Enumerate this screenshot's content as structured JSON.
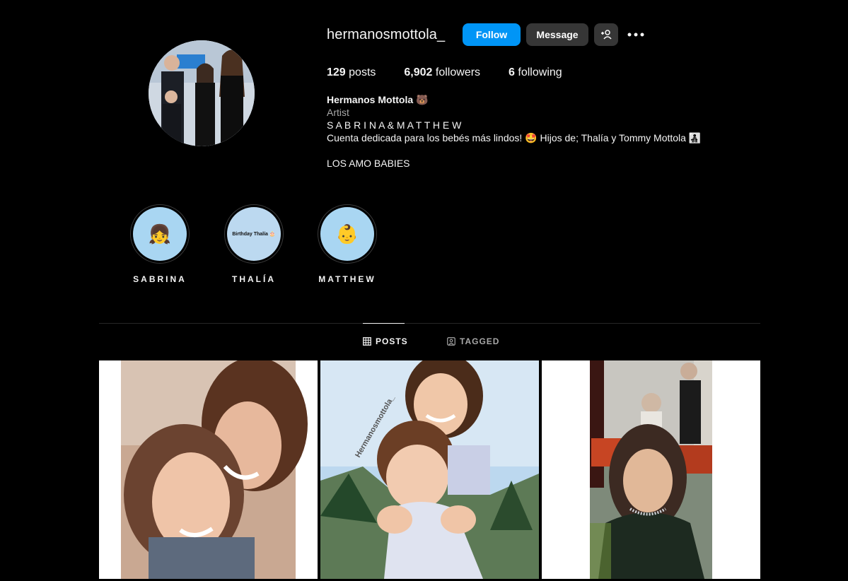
{
  "profile": {
    "username": "hermanosmottola_",
    "full_name": "Hermanos Mottola 🐻",
    "category": "Artist",
    "bio_lines": [
      "S A B R I N A & M A T T H E W",
      "Cuenta dedicada para los bebés más lindos! 🤩 Hijos de; Thalía y Tommy Mottola 👨‍👧‍👦",
      "LOS AMO BABIES"
    ]
  },
  "actions": {
    "follow_label": "Follow",
    "message_label": "Message",
    "add_user_icon": "add-user-icon",
    "more_icon": "more-options-icon"
  },
  "stats": {
    "posts_count": "129",
    "posts_label": "posts",
    "followers_count": "6,902",
    "followers_label": "followers",
    "following_count": "6",
    "following_label": "following"
  },
  "highlights": [
    {
      "label": "SABRINA",
      "cover": "👧"
    },
    {
      "label": "THALÍA",
      "cover": "Birthday Thalía 🎂"
    },
    {
      "label": "MATTHEW",
      "cover": "👶"
    }
  ],
  "tabs": [
    {
      "label": "POSTS",
      "icon": "grid-icon",
      "active": true
    },
    {
      "label": "TAGGED",
      "icon": "tagged-icon",
      "active": false
    }
  ],
  "posts": [
    {
      "alt": "photo-1"
    },
    {
      "alt": "photo-2",
      "watermark": "Hermanosmottola_"
    },
    {
      "alt": "photo-3"
    }
  ],
  "colors": {
    "background": "#000000",
    "primary_button": "#0095f6",
    "secondary_button": "#363636",
    "highlight_bg": "#a9d6f2"
  }
}
